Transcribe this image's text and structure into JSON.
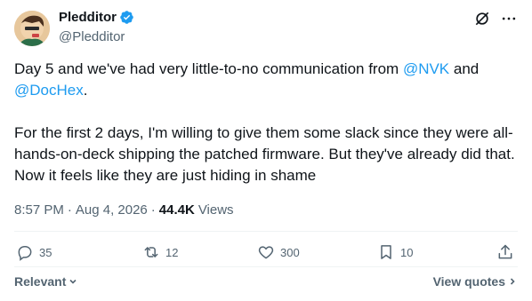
{
  "author": {
    "name": "Pledditor",
    "handle": "@Pledditor",
    "verified": true
  },
  "top_icons": [
    "grok-icon",
    "more-icon"
  ],
  "post": {
    "line1_prefix": "Day 5 and we've had very little-to-no communication from ",
    "mention1": "@NVK",
    "line1_suffix": " and",
    "mention2": "@DocHex",
    "line2_suffix": ".",
    "paragraph2": "For the first 2 days, I'm willing to give them some slack since they were all-hands-on-deck shipping the patched firmware. But they've already did that. Now it feels like they are just hiding in shame"
  },
  "meta": {
    "time": "8:57 PM",
    "separator": "·",
    "date": "Aug 4, 2026",
    "views_count": "44.4K",
    "views_label": "Views"
  },
  "actions": {
    "replies": "35",
    "reposts": "12",
    "likes": "300",
    "bookmarks": "10"
  },
  "footer": {
    "relevant_label": "Relevant",
    "view_quotes_label": "View quotes"
  },
  "colors": {
    "accent": "#1d9bf0",
    "text": "#0f1419",
    "muted": "#536471"
  }
}
